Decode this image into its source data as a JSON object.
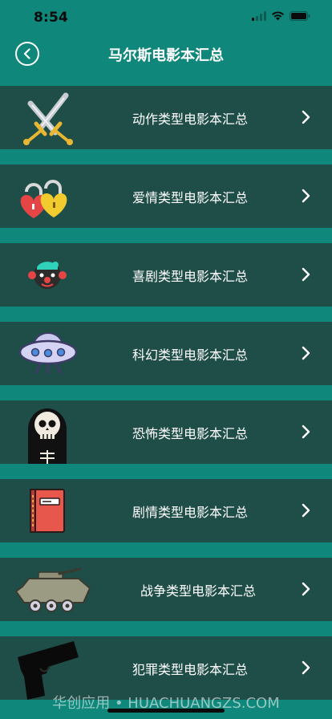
{
  "status_bar": {
    "time": "8:54"
  },
  "nav": {
    "title": "马尔斯电影本汇总",
    "back_icon": "chevron-left-circle-icon"
  },
  "colors": {
    "background": "#0f877a",
    "row_background": "#1f4e48",
    "text": "#ffffff"
  },
  "rows": [
    {
      "label": "动作类型电影本汇总",
      "icon": "crossed-swords-icon"
    },
    {
      "label": "爱情类型电影本汇总",
      "icon": "heart-padlocks-icon"
    },
    {
      "label": "喜剧类型电影本汇总",
      "icon": "clown-face-icon"
    },
    {
      "label": "科幻类型电影本汇总",
      "icon": "ufo-icon"
    },
    {
      "label": "恐怖类型电影本汇总",
      "icon": "skull-reaper-icon"
    },
    {
      "label": "剧情类型电影本汇总",
      "icon": "book-icon"
    },
    {
      "label": "战争类型电影本汇总",
      "icon": "armored-vehicle-icon"
    },
    {
      "label": "犯罪类型电影本汇总",
      "icon": "handgun-icon"
    }
  ],
  "watermark": "华创应用 • HUACHUANGZS.COM"
}
